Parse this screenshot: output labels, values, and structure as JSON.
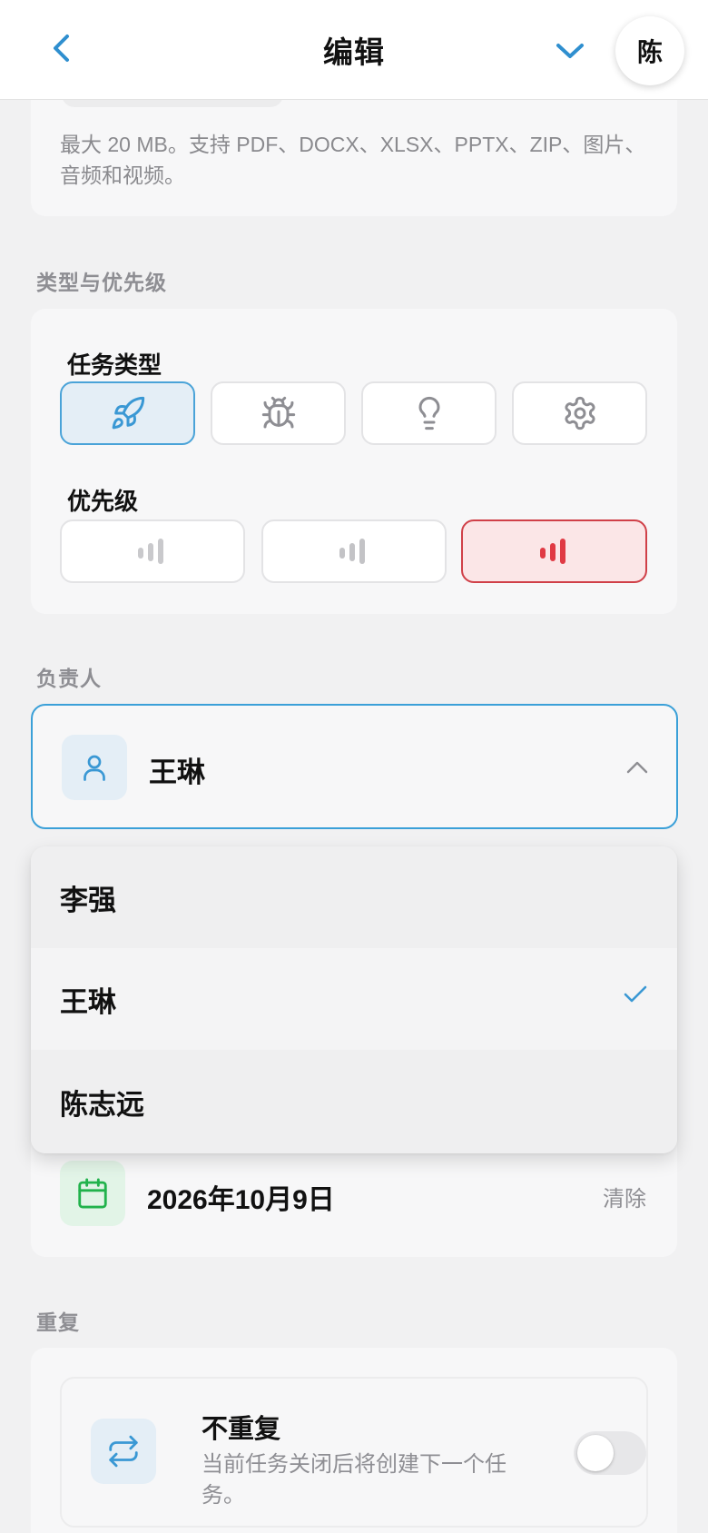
{
  "header": {
    "title": "编辑",
    "avatar_initial": "陈",
    "icons": {
      "back": "chevron-left-icon",
      "collapse": "chevron-down-icon"
    }
  },
  "upload": {
    "hint": "最大 20 MB。支持 PDF、DOCX、XLSX、PPTX、ZIP、图片、音频和视频。"
  },
  "type_priority": {
    "section_label": "类型与优先级",
    "task_type_label": "任务类型",
    "task_types": [
      {
        "icon": "rocket-icon",
        "selected": true
      },
      {
        "icon": "bug-icon",
        "selected": false
      },
      {
        "icon": "lightbulb-icon",
        "selected": false
      },
      {
        "icon": "gear-icon",
        "selected": false
      }
    ],
    "priority_label": "优先级",
    "priorities": [
      {
        "icon": "signal-low-icon",
        "level": 1,
        "selected": false
      },
      {
        "icon": "signal-medium-icon",
        "level": 2,
        "selected": false
      },
      {
        "icon": "signal-high-icon",
        "level": 3,
        "selected": true
      }
    ]
  },
  "assignee": {
    "section_label": "负责人",
    "selected": "王琳",
    "options": [
      {
        "name": "李强",
        "selected": false
      },
      {
        "name": "王琳",
        "selected": true
      },
      {
        "name": "陈志远",
        "selected": false
      }
    ]
  },
  "due_date": {
    "value": "2026年10月9日",
    "clear_label": "清除"
  },
  "repeat": {
    "section_label": "重复",
    "title": "不重复",
    "description": "当前任务关闭后将创建下一个任务。",
    "enabled": false
  },
  "colors": {
    "accent_blue": "#3ba0d8",
    "priority_red": "#e03a44",
    "date_green": "#22b24c"
  }
}
